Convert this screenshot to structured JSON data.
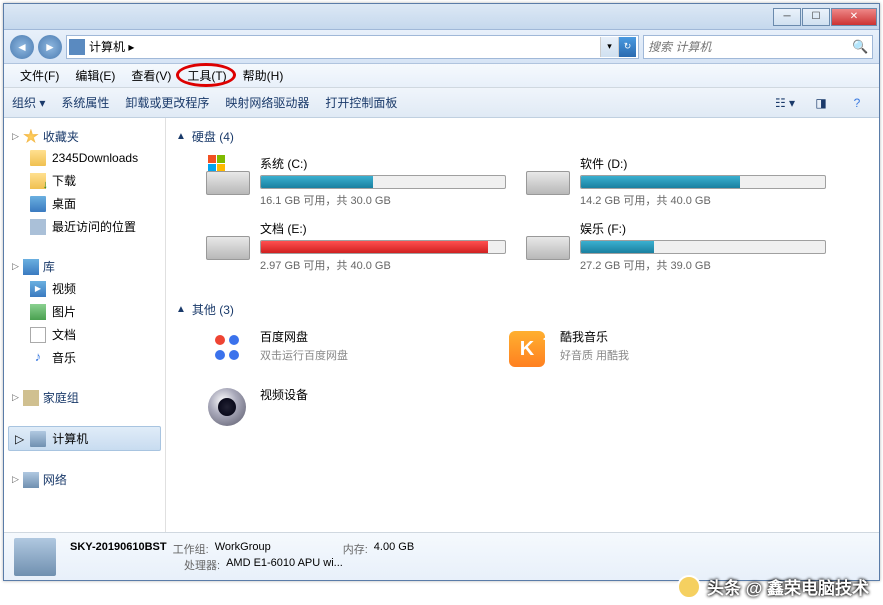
{
  "title": "计算机",
  "breadcrumb": "计算机 ▸",
  "search_placeholder": "搜索 计算机",
  "menubar": [
    {
      "label": "文件(F)"
    },
    {
      "label": "编辑(E)"
    },
    {
      "label": "查看(V)"
    },
    {
      "label": "工具(T)",
      "highlighted": true
    },
    {
      "label": "帮助(H)"
    }
  ],
  "toolbar": {
    "organize": "组织 ▾",
    "properties": "系统属性",
    "uninstall": "卸载或更改程序",
    "map_drive": "映射网络驱动器",
    "control_panel": "打开控制面板"
  },
  "sidebar": {
    "favorites": {
      "label": "收藏夹",
      "items": [
        {
          "label": "2345Downloads"
        },
        {
          "label": "下载"
        },
        {
          "label": "桌面"
        },
        {
          "label": "最近访问的位置"
        }
      ]
    },
    "libraries": {
      "label": "库",
      "items": [
        {
          "label": "视频"
        },
        {
          "label": "图片"
        },
        {
          "label": "文档"
        },
        {
          "label": "音乐"
        }
      ]
    },
    "homegroup": {
      "label": "家庭组"
    },
    "computer": {
      "label": "计算机"
    },
    "network": {
      "label": "网络"
    }
  },
  "sections": {
    "drives_label": "硬盘 (4)",
    "others_label": "其他 (3)"
  },
  "drives": [
    {
      "name": "系统 (C:)",
      "free": "16.1 GB 可用，共 30.0 GB",
      "fill_pct": 46,
      "color": "linear-gradient(#3ab0d0,#1a80a0)",
      "sys": true
    },
    {
      "name": "软件 (D:)",
      "free": "14.2 GB 可用，共 40.0 GB",
      "fill_pct": 65,
      "color": "linear-gradient(#3ab0d0,#1a80a0)"
    },
    {
      "name": "文档 (E:)",
      "free": "2.97 GB 可用，共 40.0 GB",
      "fill_pct": 93,
      "color": "linear-gradient(#ff5050,#d02020)"
    },
    {
      "name": "娱乐 (F:)",
      "free": "27.2 GB 可用，共 39.0 GB",
      "fill_pct": 30,
      "color": "linear-gradient(#3ab0d0,#1a80a0)"
    }
  ],
  "others": [
    {
      "name": "百度网盘",
      "sub": "双击运行百度网盘",
      "icon": "baidu"
    },
    {
      "name": "酷我音乐",
      "sub": "好音质 用酷我",
      "icon": "kuwo"
    },
    {
      "name": "视频设备",
      "sub": "",
      "icon": "cam"
    }
  ],
  "statusbar": {
    "name": "SKY-20190610BST",
    "workgroup_label": "工作组:",
    "workgroup": "WorkGroup",
    "memory_label": "内存:",
    "memory": "4.00 GB",
    "cpu_label": "处理器:",
    "cpu": "AMD E1-6010 APU wi..."
  },
  "watermark": "头条 @ 鑫荣电脑技术"
}
